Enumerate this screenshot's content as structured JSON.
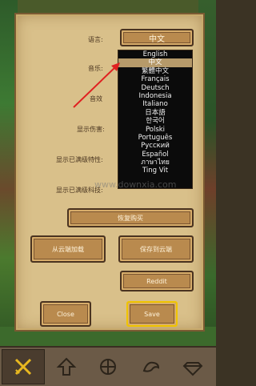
{
  "settings": {
    "language_label": "语言:",
    "music_label": "音乐:",
    "sound_label": "音效",
    "show_damage_label": "显示伤害:",
    "show_trait_label": "显示已满级特性:",
    "show_level_label": "显示已满级科技:"
  },
  "language_button": "中文",
  "languages": [
    "English",
    "中文",
    "繁體中文",
    "Français",
    "Deutsch",
    "Indonesia",
    "Italiano",
    "日本語",
    "한국어",
    "Polski",
    "Português",
    "Русский",
    "Español",
    "ภาษาไทย",
    "Ting Vit"
  ],
  "selected_language_index": 1,
  "buttons": {
    "restore": "恢复购买",
    "cloud_load": "从云端加载",
    "cloud_save": "保存到云端",
    "reddit": "Reddit",
    "close": "Close",
    "save": "Save"
  },
  "watermark": "www.downxia.com",
  "bottom_tabs": [
    "swords-icon",
    "arrow-up-icon",
    "helmet-icon",
    "dragon-icon",
    "gem-icon"
  ]
}
